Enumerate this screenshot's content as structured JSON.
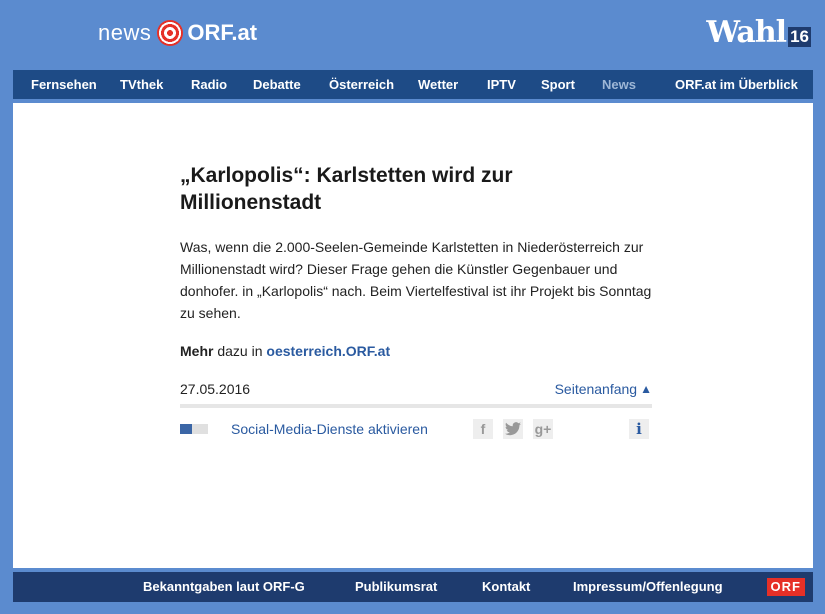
{
  "header": {
    "logo_news": "news",
    "logo_orf": "ORF.at",
    "wahl_text": "Wahl",
    "wahl_year": "16"
  },
  "nav": {
    "items": [
      {
        "label": "Fernsehen"
      },
      {
        "label": "TVthek"
      },
      {
        "label": "Radio"
      },
      {
        "label": "Debatte"
      },
      {
        "label": "Österreich"
      },
      {
        "label": "Wetter"
      },
      {
        "label": "IPTV"
      },
      {
        "label": "Sport"
      },
      {
        "label": "News"
      },
      {
        "label": "ORF.at im Überblick"
      }
    ]
  },
  "article": {
    "title": "„Karlopolis“: Karlstetten wird zur Millionenstadt",
    "lead": "Was, wenn die 2.000-Seelen-Gemeinde Karlstetten in Niederösterreich zur Millionenstadt wird? Dieser Frage gehen die Künstler Gegenbauer und donhofer. in „Karlopolis“ nach. Beim Viertelfestival ist ihr Projekt bis Sonntag zu sehen.",
    "more_bold": "Mehr",
    "more_text": " dazu in ",
    "more_link": "oesterreich.ORF.at",
    "date": "27.05.2016",
    "top_link": "Seitenanfang",
    "top_arrow": "▲",
    "social_label": "Social-Media-Dienste aktivieren",
    "share_facebook": "f",
    "share_gplus": "g+",
    "info": "i"
  },
  "footer": {
    "links": [
      {
        "label": "Bekanntgaben laut ORF-G"
      },
      {
        "label": "Publikumsrat"
      },
      {
        "label": "Kontakt"
      },
      {
        "label": "Impressum/Offenlegung"
      }
    ],
    "logo": "ORF"
  },
  "colors": {
    "background": "#5b8bcf",
    "nav": "#1e4b86",
    "footer": "#1e3b6e",
    "link": "#2a5aa0",
    "brand_red": "#e63027"
  }
}
